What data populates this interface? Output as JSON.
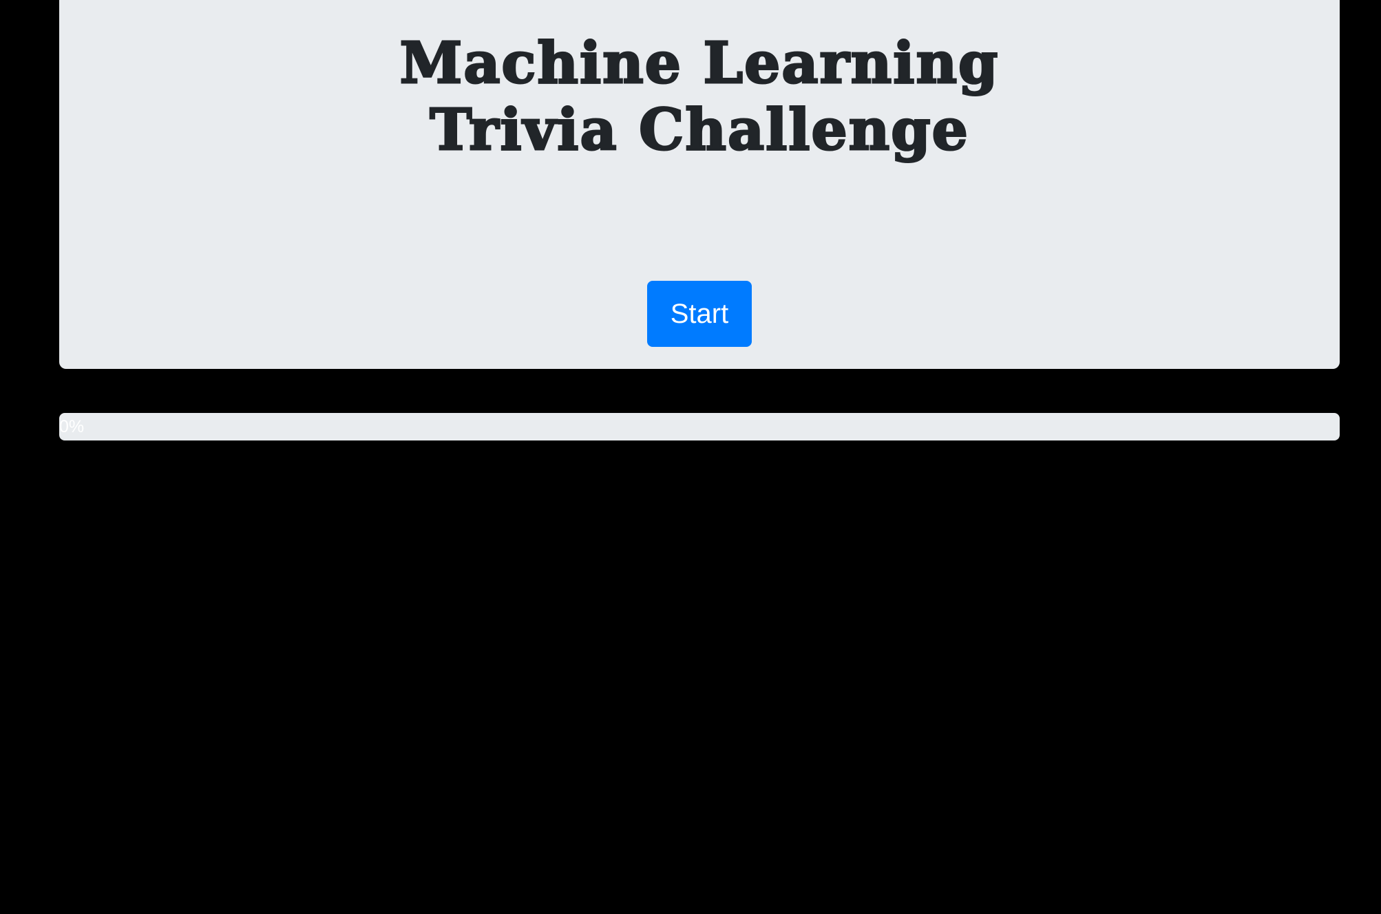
{
  "header": {
    "title": "Machine Learning Trivia Challenge",
    "start_label": "Start"
  },
  "progress": {
    "label": "0%",
    "value": 0
  },
  "colors": {
    "background": "#000000",
    "panel": "#e9ecef",
    "accent": "#007bff",
    "text": "#212529"
  }
}
